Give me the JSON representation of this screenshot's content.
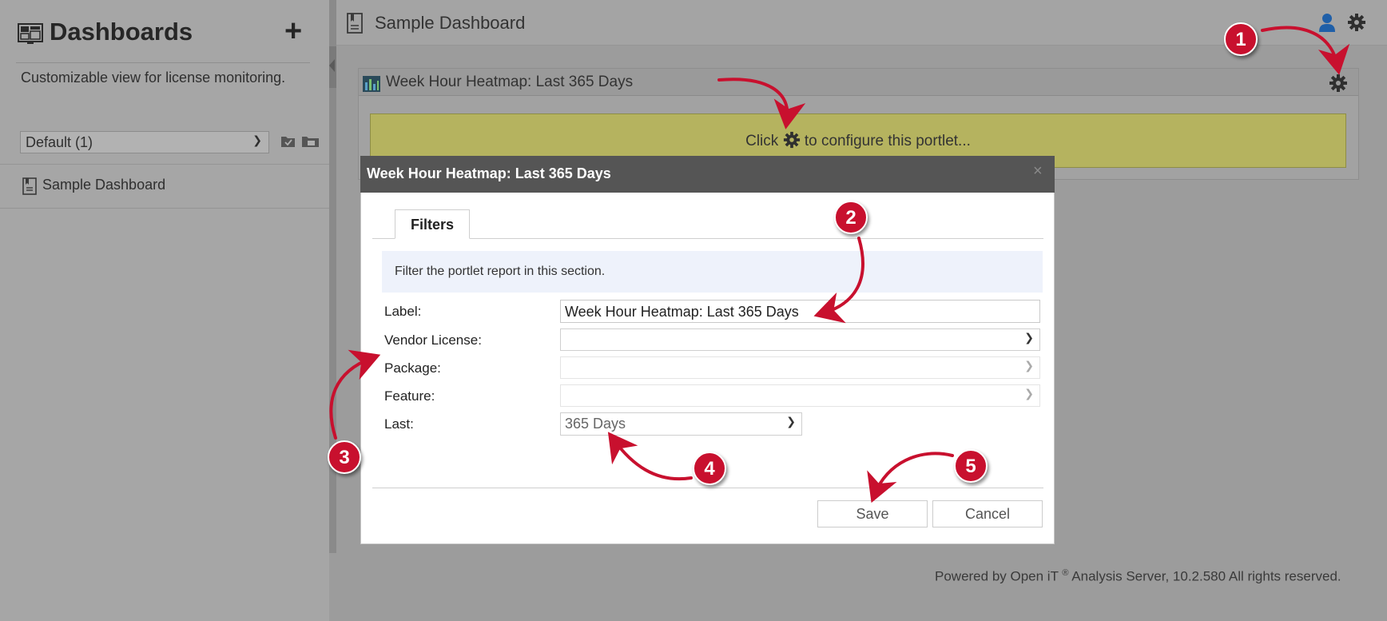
{
  "sidebar": {
    "title": "Dashboards",
    "add_label": "+",
    "description": "Customizable view for license monitoring.",
    "dashboard_select": "Default (1)",
    "items": [
      {
        "label": "Sample Dashboard"
      }
    ]
  },
  "main": {
    "title": "Sample Dashboard",
    "portlet": {
      "title": "Week Hour Heatmap: Last 365 Days",
      "configure_before": "Click",
      "configure_after": "to configure this portlet..."
    }
  },
  "modal": {
    "title": "Week Hour Heatmap: Last 365 Days",
    "close": "×",
    "tabs": [
      {
        "label": "Filters"
      }
    ],
    "description": "Filter the portlet report in this section.",
    "fields": {
      "label": {
        "label": "Label:",
        "value": "Week Hour Heatmap: Last 365 Days"
      },
      "vendor": {
        "label": "Vendor License:",
        "value": ""
      },
      "package": {
        "label": "Package:",
        "value": ""
      },
      "feature": {
        "label": "Feature:",
        "value": ""
      },
      "last": {
        "label": "Last:",
        "value": "365 Days"
      }
    },
    "save_label": "Save",
    "cancel_label": "Cancel"
  },
  "footer": {
    "before": "Powered by Open iT",
    "reg": "®",
    "after": " Analysis Server, 10.2.580 All rights reserved."
  },
  "callouts": [
    "1",
    "2",
    "3",
    "4",
    "5"
  ],
  "colors": {
    "callout": "#c8102e",
    "modal_header": "#555555",
    "portlet_body": "#b5b35f",
    "overlay": "#9c9c9c",
    "user_icon": "#1f5fa8"
  },
  "icons": {
    "sidebar_title": "dashboard-icon",
    "page": "page-icon",
    "user": "user-icon",
    "settings": "gear-icon",
    "portlet": "bar-chart-icon",
    "folders": [
      "folder-open-icon",
      "folder-share-icon"
    ]
  }
}
